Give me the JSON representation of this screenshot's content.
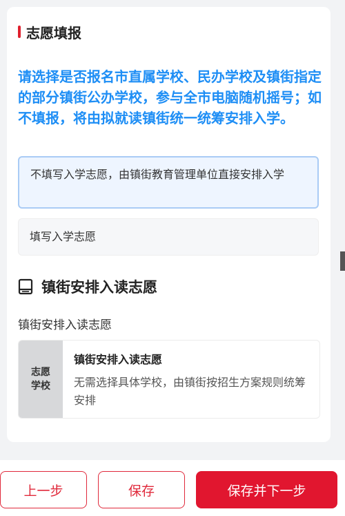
{
  "section": {
    "title": "志愿填报"
  },
  "notice": "请选择是否报名市直属学校、民办学校及镇街指定的部分镇街公办学校，参与全市电脑随机摇号；如不填报，将由拟就读镇街统一统筹安排入学。",
  "options": [
    {
      "label": "不填写入学志愿，由镇街教育管理单位直接安排入学",
      "selected": true
    },
    {
      "label": "填写入学志愿",
      "selected": false
    }
  ],
  "arrangement": {
    "heading": "镇街安排入读志愿",
    "icon": "book-icon",
    "sub_label": "镇街安排入读志愿",
    "card": {
      "tag_line1": "志愿",
      "tag_line2": "学校",
      "title": "镇街安排入读志愿",
      "description": "无需选择具体学校，由镇街按招生方案规则统筹安排"
    }
  },
  "buttons": {
    "prev": "上一步",
    "save": "保存",
    "save_next": "保存并下一步"
  },
  "colors": {
    "accent": "#e1162f",
    "notice_blue": "#1e8ef5",
    "selected_bg": "#eef5ff"
  }
}
